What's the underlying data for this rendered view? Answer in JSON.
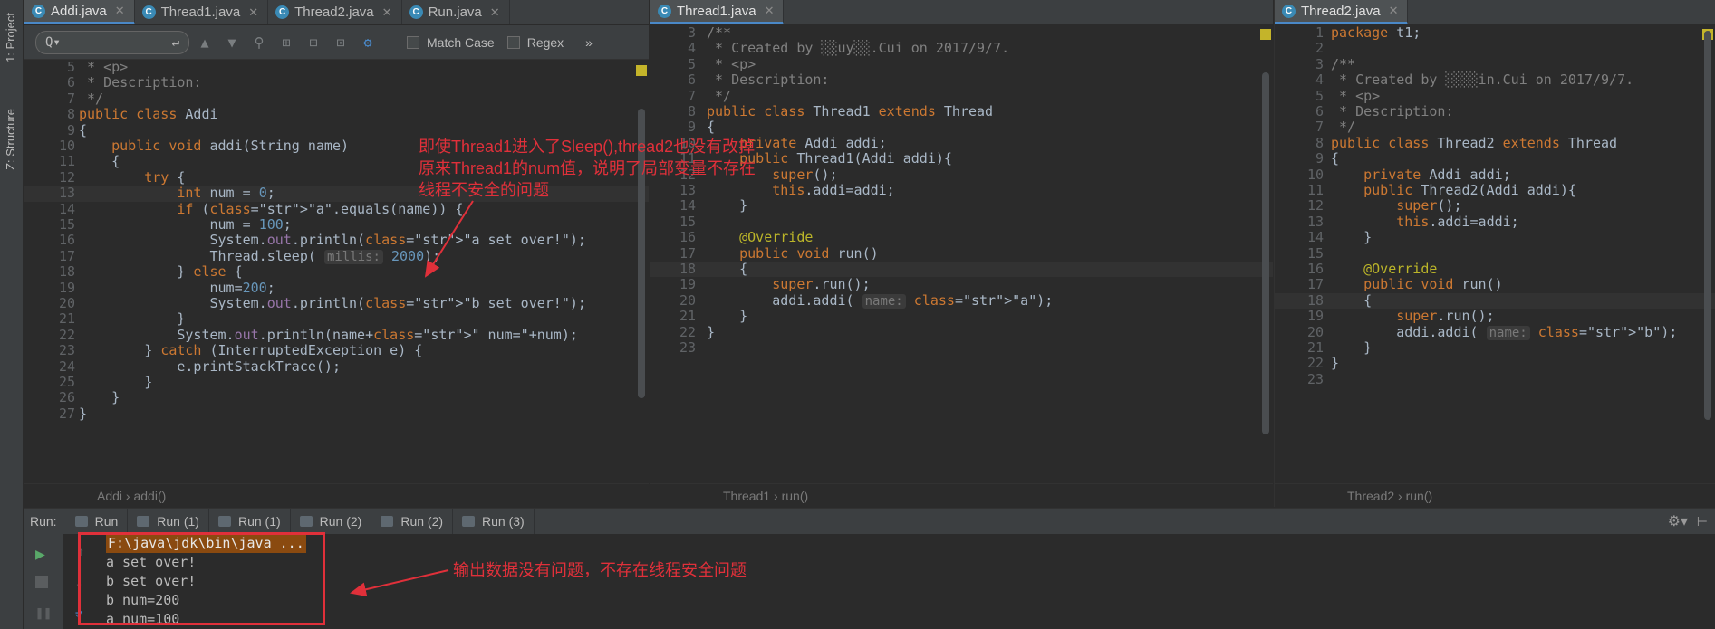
{
  "sidebar": {
    "project_label": "1: Project",
    "structure_label": "Z: Structure"
  },
  "panes": [
    {
      "tabs": [
        {
          "label": "Addi.java",
          "active": true
        },
        {
          "label": "Thread1.java",
          "active": false
        },
        {
          "label": "Thread2.java",
          "active": false
        },
        {
          "label": "Run.java",
          "active": false
        }
      ],
      "find": {
        "placeholder": "Q▾",
        "match_case": "Match Case",
        "regex": "Regex",
        "more": "»"
      },
      "breadcrumb": [
        "Addi",
        "addi()"
      ]
    },
    {
      "tabs": [
        {
          "label": "Thread1.java",
          "active": true
        }
      ],
      "breadcrumb": [
        "Thread1",
        "run()"
      ]
    },
    {
      "tabs": [
        {
          "label": "Thread2.java",
          "active": true
        }
      ],
      "breadcrumb": [
        "Thread2",
        "run()"
      ]
    }
  ],
  "code1": [
    {
      "n": "5",
      "t": " * <p>"
    },
    {
      "n": "6",
      "t": " * Description:"
    },
    {
      "n": "7",
      "t": " */"
    },
    {
      "n": "8",
      "t": "public class Addi"
    },
    {
      "n": "9",
      "t": "{"
    },
    {
      "n": "10",
      "t": "    public void addi(String name)"
    },
    {
      "n": "11",
      "t": "    {"
    },
    {
      "n": "12",
      "t": "        try {"
    },
    {
      "n": "13",
      "t": "            int num = 0;"
    },
    {
      "n": "14",
      "t": "            if (\"a\".equals(name)) {"
    },
    {
      "n": "15",
      "t": "                num = 100;"
    },
    {
      "n": "16",
      "t": "                System.out.println(\"a set over!\");"
    },
    {
      "n": "17",
      "t": "                Thread.sleep( millis: 2000);"
    },
    {
      "n": "18",
      "t": "            } else {"
    },
    {
      "n": "19",
      "t": "                num=200;"
    },
    {
      "n": "20",
      "t": "                System.out.println(\"b set over!\");"
    },
    {
      "n": "21",
      "t": "            }"
    },
    {
      "n": "22",
      "t": "            System.out.println(name+\" num=\"+num);"
    },
    {
      "n": "23",
      "t": "        } catch (InterruptedException e) {"
    },
    {
      "n": "24",
      "t": "            e.printStackTrace();"
    },
    {
      "n": "25",
      "t": "        }"
    },
    {
      "n": "26",
      "t": "    }"
    },
    {
      "n": "27",
      "t": "}"
    }
  ],
  "code2": [
    {
      "n": "3",
      "t": "/**"
    },
    {
      "n": "4",
      "t": " * Created by ░░uy░░.Cui on 2017/9/7."
    },
    {
      "n": "5",
      "t": " * <p>"
    },
    {
      "n": "6",
      "t": " * Description:"
    },
    {
      "n": "7",
      "t": " */"
    },
    {
      "n": "8",
      "t": "public class Thread1 extends Thread"
    },
    {
      "n": "9",
      "t": "{"
    },
    {
      "n": "10",
      "t": "    private Addi addi;"
    },
    {
      "n": "11",
      "t": "    public Thread1(Addi addi){"
    },
    {
      "n": "12",
      "t": "        super();"
    },
    {
      "n": "13",
      "t": "        this.addi=addi;"
    },
    {
      "n": "14",
      "t": "    }"
    },
    {
      "n": "15",
      "t": ""
    },
    {
      "n": "16",
      "t": "    @Override"
    },
    {
      "n": "17",
      "t": "    public void run()"
    },
    {
      "n": "18",
      "t": "    {"
    },
    {
      "n": "19",
      "t": "        super.run();"
    },
    {
      "n": "20",
      "t": "        addi.addi( name: \"a\");"
    },
    {
      "n": "21",
      "t": "    }"
    },
    {
      "n": "22",
      "t": "}"
    },
    {
      "n": "23",
      "t": ""
    }
  ],
  "code3": [
    {
      "n": "1",
      "t": "package t1;"
    },
    {
      "n": "2",
      "t": ""
    },
    {
      "n": "3",
      "t": "/**"
    },
    {
      "n": "4",
      "t": " * Created by ░░░░in.Cui on 2017/9/7."
    },
    {
      "n": "5",
      "t": " * <p>"
    },
    {
      "n": "6",
      "t": " * Description:"
    },
    {
      "n": "7",
      "t": " */"
    },
    {
      "n": "8",
      "t": "public class Thread2 extends Thread"
    },
    {
      "n": "9",
      "t": "{"
    },
    {
      "n": "10",
      "t": "    private Addi addi;"
    },
    {
      "n": "11",
      "t": "    public Thread2(Addi addi){"
    },
    {
      "n": "12",
      "t": "        super();"
    },
    {
      "n": "13",
      "t": "        this.addi=addi;"
    },
    {
      "n": "14",
      "t": "    }"
    },
    {
      "n": "15",
      "t": ""
    },
    {
      "n": "16",
      "t": "    @Override"
    },
    {
      "n": "17",
      "t": "    public void run()"
    },
    {
      "n": "18",
      "t": "    {"
    },
    {
      "n": "19",
      "t": "        super.run();"
    },
    {
      "n": "20",
      "t": "        addi.addi( name: \"b\");"
    },
    {
      "n": "21",
      "t": "    }"
    },
    {
      "n": "22",
      "t": "}"
    },
    {
      "n": "23",
      "t": ""
    }
  ],
  "run": {
    "label": "Run:",
    "tabs": [
      "Run",
      "Run (1)",
      "Run (1)",
      "Run (2)",
      "Run (2)",
      "Run (3)"
    ],
    "console": [
      "F:\\java\\jdk\\bin\\java ...",
      "a set over!",
      "b set over!",
      "b num=200",
      "a num=100"
    ]
  },
  "annotations": {
    "note1": [
      "即使Thread1进入了Sleep(),thread2也没有改掉",
      "原来Thread1的num值，说明了局部变量不存在",
      "线程不安全的问题"
    ],
    "note2": "输出数据没有问题，不存在线程安全问题"
  },
  "colors": {
    "accent": "#4a88c7",
    "annotation": "#e0303a",
    "background": "#2b2b2b"
  }
}
